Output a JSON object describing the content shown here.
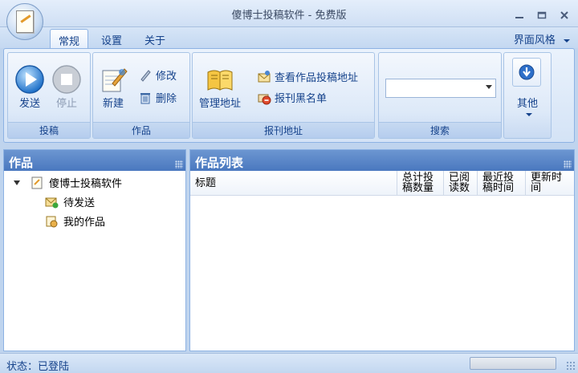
{
  "window": {
    "title": "傻博士投稿软件 - 免费版",
    "app_icon": "notepad-pen-icon",
    "controls": [
      "minimize-icon",
      "maximize-icon",
      "close-icon"
    ]
  },
  "tabs": [
    {
      "label": "常规",
      "active": true
    },
    {
      "label": "设置",
      "active": false
    },
    {
      "label": "关于",
      "active": false
    }
  ],
  "skin_menu": {
    "label": "界面风格",
    "icon": "chevron-down-icon"
  },
  "ribbon": {
    "groups": {
      "submit": {
        "label": "投稿",
        "send": {
          "label": "发送",
          "icon": "play-icon"
        },
        "stop": {
          "label": "停止",
          "icon": "stop-icon",
          "enabled": false
        }
      },
      "works": {
        "label": "作品",
        "new": {
          "label": "新建",
          "icon": "new-document-icon"
        },
        "edit": {
          "label": "修改",
          "icon": "pencil-icon"
        },
        "delete": {
          "label": "删除",
          "icon": "trash-icon"
        }
      },
      "address": {
        "label": "报刊地址",
        "manage": {
          "label": "管理地址",
          "icon": "address-book-icon"
        },
        "view": {
          "label": "查看作品投稿地址",
          "icon": "envelope-view-icon"
        },
        "blacklist": {
          "label": "报刊黑名单",
          "icon": "blacklist-icon"
        }
      },
      "search": {
        "label": "搜索",
        "value": ""
      },
      "other": {
        "label": "其他",
        "icon": "down-arrow-circle-icon"
      }
    }
  },
  "works_panel": {
    "title": "作品",
    "tree": {
      "root": {
        "label": "傻博士投稿软件",
        "icon": "notepad-icon",
        "expanded": true
      },
      "children": [
        {
          "label": "待发送",
          "icon": "envelope-pending-icon"
        },
        {
          "label": "我的作品",
          "icon": "my-works-icon"
        }
      ]
    }
  },
  "list_panel": {
    "title": "作品列表",
    "columns": [
      "标题",
      "总计投稿数量",
      "已阅读数",
      "最近投稿时间",
      "更新时间"
    ],
    "rows": []
  },
  "status": {
    "text": "状态：已登陆",
    "progress": 0
  },
  "colors": {
    "accent": "#15428b",
    "panel_header": "#5a86c8",
    "background": "#bfd4ee"
  }
}
